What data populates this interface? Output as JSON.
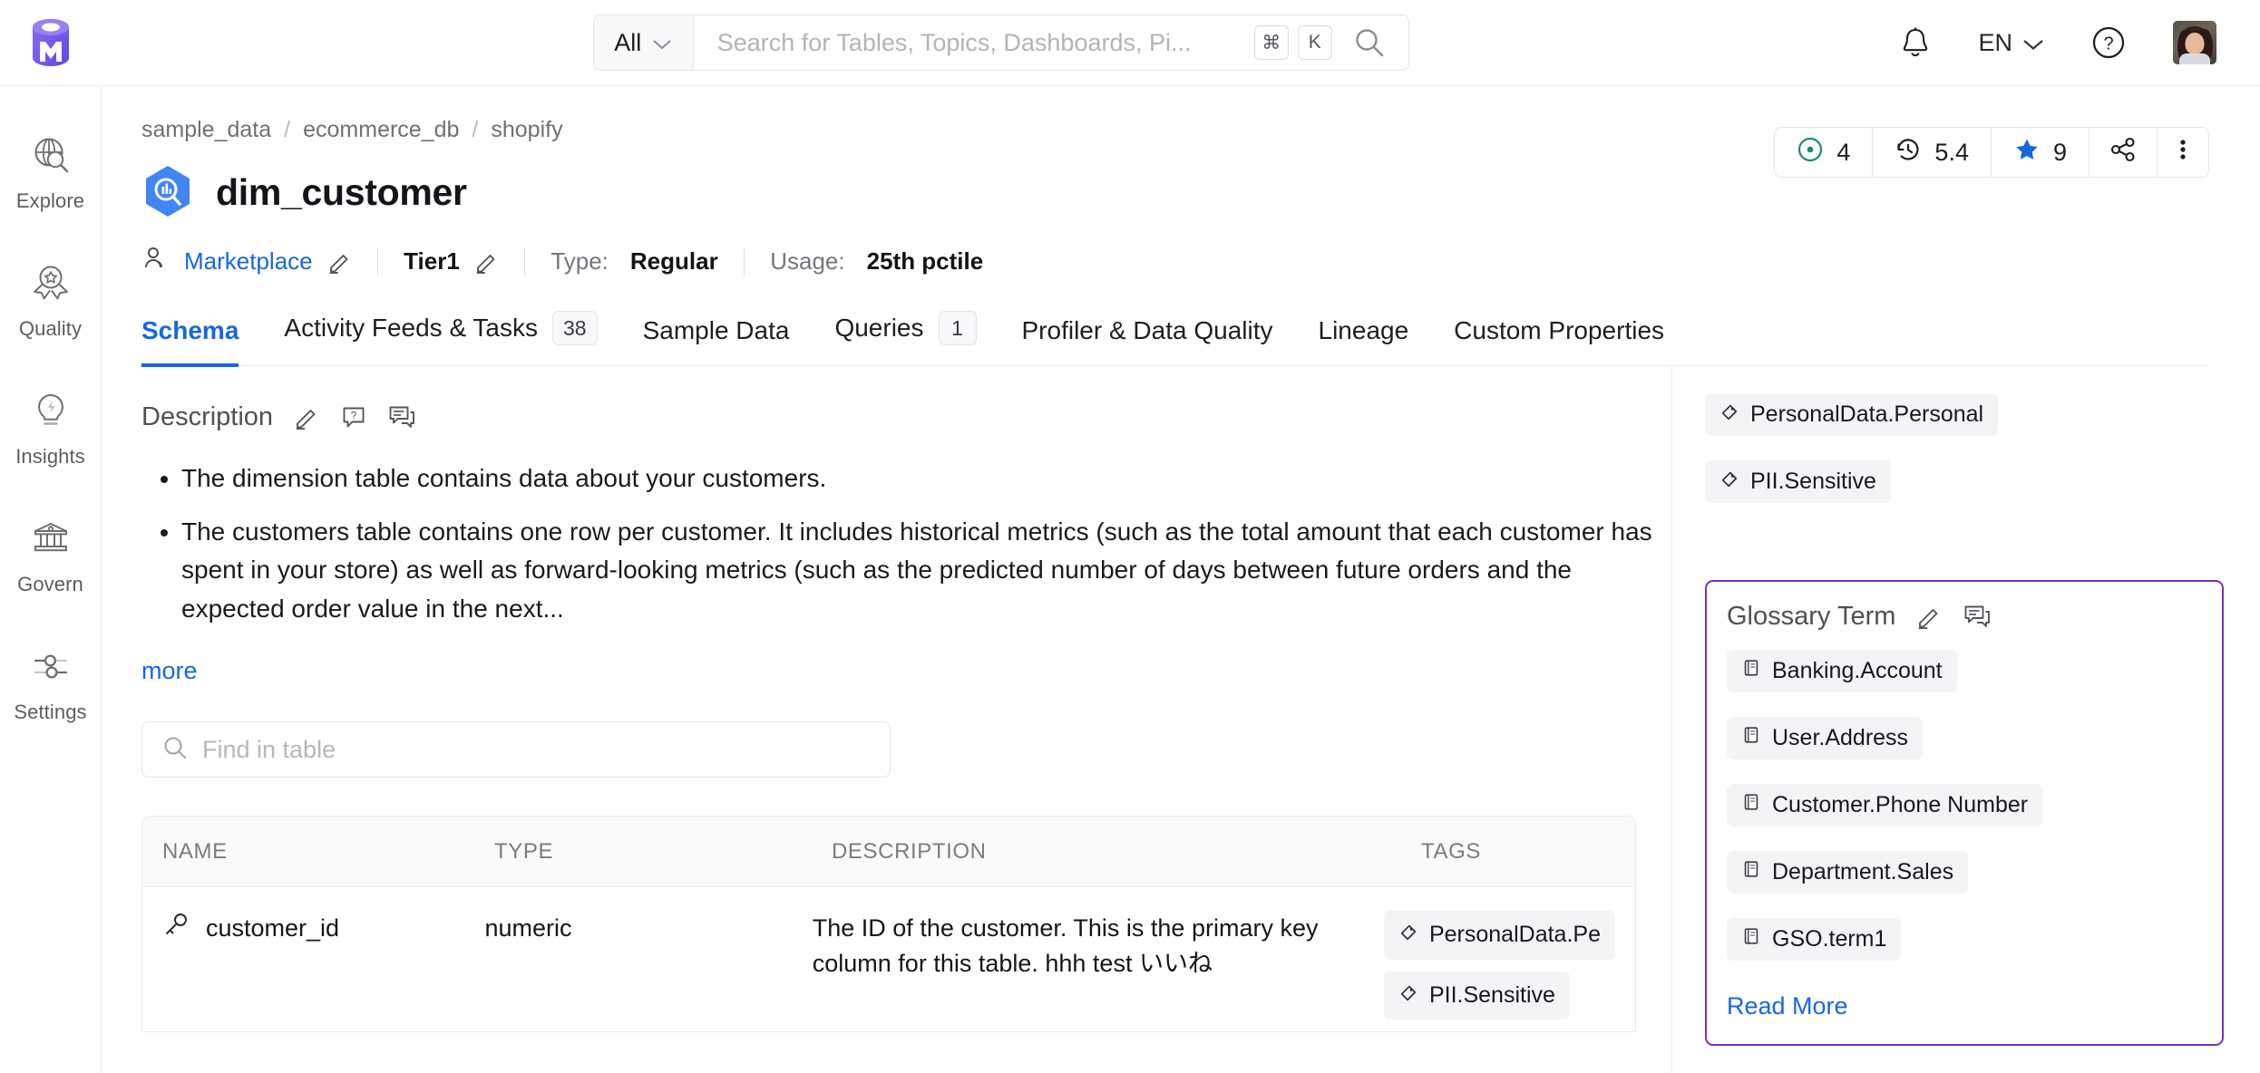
{
  "header": {
    "logo_name": "openmetadata-logo",
    "search": {
      "filter_label": "All",
      "placeholder": "Search for Tables, Topics, Dashboards, Pi...",
      "value": "",
      "kbd_modifier": "⌘",
      "kbd_key": "K"
    },
    "language": "EN",
    "notification_icon": "bell-icon",
    "help_icon": "help-circle-icon",
    "avatar_name": "user-avatar"
  },
  "sidebar": {
    "items": [
      {
        "label": "Explore",
        "icon": "explore-globe-icon"
      },
      {
        "label": "Quality",
        "icon": "quality-badge-icon"
      },
      {
        "label": "Insights",
        "icon": "insights-bulb-icon"
      },
      {
        "label": "Govern",
        "icon": "govern-bank-icon"
      },
      {
        "label": "Settings",
        "icon": "settings-sliders-icon"
      }
    ]
  },
  "page": {
    "breadcrumb": [
      "sample_data",
      "ecommerce_db",
      "shopify"
    ],
    "breadcrumb_separator": "/",
    "title": "dim_customer",
    "entity_icon": "bigquery-table-icon",
    "stats": [
      {
        "name": "votes-up",
        "icon": "circle-dot-icon",
        "value": "4",
        "color": "#1b8a7a"
      },
      {
        "name": "version",
        "icon": "history-clock-icon",
        "value": "5.4"
      },
      {
        "name": "followers",
        "icon": "star-icon",
        "value": "9",
        "color": "#1668dc"
      },
      {
        "name": "share",
        "icon": "share-icon",
        "value": ""
      },
      {
        "name": "more-menu",
        "icon": "kebab-menu-icon",
        "value": ""
      }
    ],
    "meta": {
      "owner_label": "Marketplace",
      "owner_icon": "team-people-icon",
      "tier_label": "Tier1",
      "type_key": "Type:",
      "type_value": "Regular",
      "usage_key": "Usage:",
      "usage_value": "25th pctile",
      "edit_icon": "pencil-icon"
    },
    "tabs": [
      {
        "label": "Schema",
        "count": "",
        "active": true
      },
      {
        "label": "Activity Feeds & Tasks",
        "count": "38",
        "active": false
      },
      {
        "label": "Sample Data",
        "count": "",
        "active": false
      },
      {
        "label": "Queries",
        "count": "1",
        "active": false
      },
      {
        "label": "Profiler & Data Quality",
        "count": "",
        "active": false
      },
      {
        "label": "Lineage",
        "count": "",
        "active": false
      },
      {
        "label": "Custom Properties",
        "count": "",
        "active": false
      }
    ]
  },
  "description": {
    "title": "Description",
    "edit_icon": "pencil-icon",
    "request_icon": "request-description-icon",
    "comment_icon": "comment-icon",
    "bullets": [
      "The dimension table contains data about your customers.",
      "The customers table contains one row per customer. It includes historical metrics (such as the total amount that each customer has spent in your store) as well as forward-looking metrics (such as the predicted number of days between future orders and the expected order value in the next..."
    ],
    "more_label": "more"
  },
  "find_in_table": {
    "placeholder": "Find in table",
    "value": "",
    "icon": "search-icon"
  },
  "schema_table": {
    "columns": [
      "NAME",
      "TYPE",
      "DESCRIPTION",
      "TAGS"
    ],
    "rows": [
      {
        "name": "customer_id",
        "name_icon": "primary-key-icon",
        "type": "numeric",
        "description": "The ID of the customer. This is the primary key column for this table. hhh test  いいね",
        "tags": [
          "PersonalData.Pe",
          "PII.Sensitive"
        ]
      }
    ]
  },
  "right_panel": {
    "tags": [
      {
        "label": "PersonalData.Personal",
        "icon": "tag-icon"
      },
      {
        "label": "PII.Sensitive",
        "icon": "tag-icon"
      }
    ],
    "glossary": {
      "title": "Glossary Term",
      "edit_icon": "pencil-icon",
      "comment_icon": "comment-icon",
      "border_color": "#7a2fbe",
      "terms": [
        {
          "label": "Banking.Account",
          "icon": "glossary-book-icon"
        },
        {
          "label": "User.Address",
          "icon": "glossary-book-icon"
        },
        {
          "label": "Customer.Phone Number",
          "icon": "glossary-book-icon"
        },
        {
          "label": "Department.Sales",
          "icon": "glossary-book-icon"
        },
        {
          "label": "GSO.term1",
          "icon": "glossary-book-icon"
        }
      ],
      "read_more": "Read More"
    }
  }
}
